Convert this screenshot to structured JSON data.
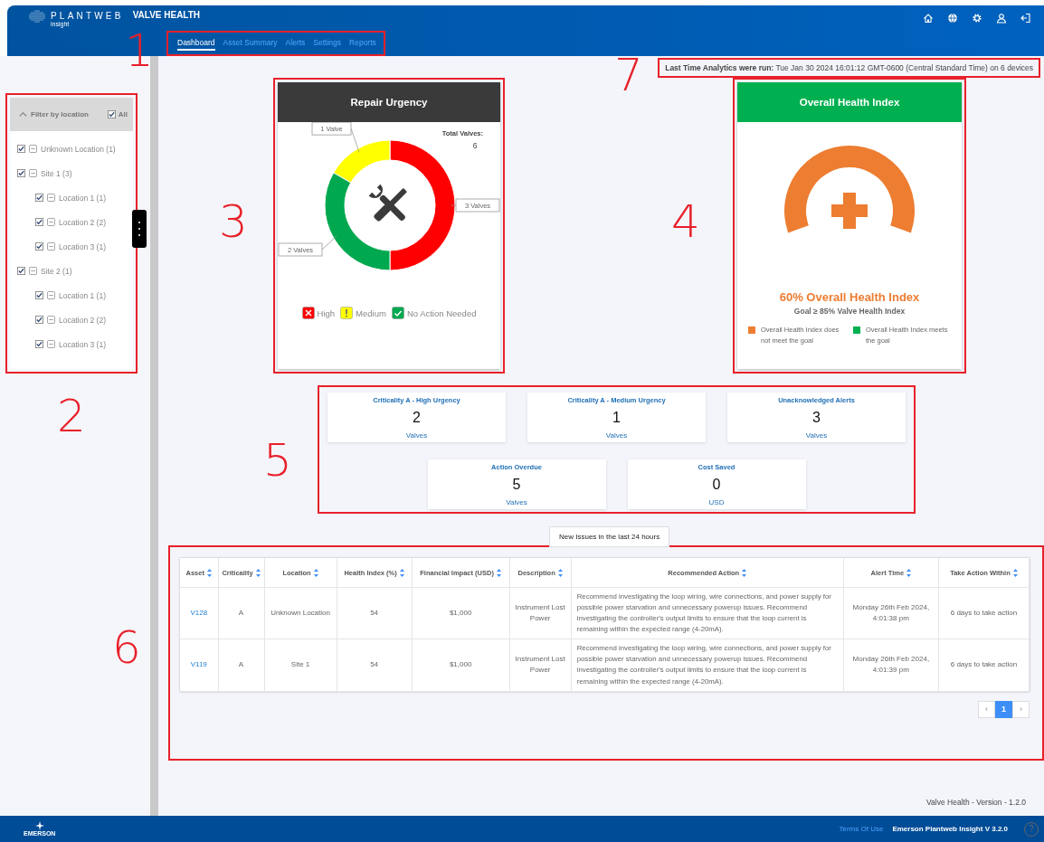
{
  "header": {
    "logo_text": "PLANTWEB",
    "logo_subtext": "insight",
    "app_title": "VALVE HEALTH"
  },
  "nav": {
    "annotation": "1",
    "tabs": [
      {
        "label": "Dashboard",
        "selected": true
      },
      {
        "label": "Asset Summary",
        "selected": false
      },
      {
        "label": "Alerts",
        "selected": false
      },
      {
        "label": "Settings",
        "selected": false
      },
      {
        "label": "Reports",
        "selected": false
      }
    ]
  },
  "analytics": {
    "annotation": "7",
    "text": "**Last Time Analytics were run:** Tue Jan 30 2024 16:01:12 GMT-0600 (Central Standard Time) on 6 devices"
  },
  "filter": {
    "annotation": "2",
    "title": "Filter by location",
    "expanded": true,
    "all": {
      "label": "All",
      "checked": true
    },
    "items": [
      {
        "label": "Unknown Location (1)",
        "checked": true
      },
      {
        "label": "Site 1 (3)",
        "checked": true,
        "children": [
          {
            "label": "Location 1 (1)",
            "checked": true
          },
          {
            "label": "Location 2 (2)",
            "checked": true
          },
          {
            "label": "Location 3 (1)",
            "checked": true
          }
        ]
      },
      {
        "label": "Site 2 (1)",
        "checked": true,
        "children": [
          {
            "label": "Location 1 (1)",
            "checked": true
          },
          {
            "label": "Location 2 (2)",
            "checked": true
          },
          {
            "label": "Location 3 (1)",
            "checked": true
          }
        ]
      }
    ]
  },
  "repair_urgency": {
    "annotation": "3",
    "title": "Repair Urgency",
    "total_label": "Total Valves:",
    "total": "6",
    "chart_data": {
      "type": "donut",
      "categories": [
        "High",
        "Medium",
        "No Action Needed"
      ],
      "values": [
        3,
        1,
        2
      ],
      "value_labels": [
        "3 Valves",
        "1 Valve",
        "2 Valves"
      ]
    },
    "legend": [
      {
        "kind": "cross",
        "color": "#ff0000"
      },
      {
        "kind": "exclamation",
        "color": "#ffff00"
      },
      {
        "kind": "check",
        "color": "#00a94f"
      }
    ]
  },
  "health": {
    "annotation": "4",
    "title": "Overall Health Index",
    "meets_goal": false,
    "value_text": "60% Overall Health Index",
    "goal_text": "Goal ≥ 85% Valve Health Index",
    "legend": [
      {
        "label": "Overall Health Index does not meet the goal",
        "color": "#ed7d31"
      },
      {
        "label": "Overall Health Index meets the goal",
        "color": "#00b050"
      }
    ]
  },
  "kpis": {
    "annotation": "5",
    "cards": [
      {
        "title": "Criticality A - High Urgency",
        "value": "2",
        "unit": "Valves"
      },
      {
        "title": "Criticality A - Medium Urgency",
        "value": "1",
        "unit": "Valves"
      },
      {
        "title": "Unacknowledged Alerts",
        "value": "3",
        "unit": "Valves"
      },
      {
        "title": "Action Overdue",
        "value": "5",
        "unit": "Valves"
      },
      {
        "title": "Cost Saved",
        "value": "0",
        "unit": "USD"
      }
    ]
  },
  "issues": {
    "annotation": "6",
    "tab": "New Issues in the last 24 hours",
    "columns": [
      "Asset",
      "Criticality",
      "Location",
      "Health Index (%)",
      "Financial Impact (USD)",
      "Description",
      "Recommended Action",
      "Alert Time",
      "Take Action Within"
    ],
    "rows": [
      {
        "cells": [
          "V128",
          "A",
          "Unknown Location",
          "54",
          "$1,000",
          "Instrument Lost Power",
          "Recommend investigating the loop wiring, wire connections, and power supply for possible power starvation and unnecessary powerup issues. Recommend investigating the controller's output limits to ensure that the loop current is remaining within the expected range (4-20mA).",
          "Monday 26th Feb 2024, 4:01:38 pm",
          "6 days to take action"
        ]
      },
      {
        "cells": [
          "V119",
          "A",
          "Site 1",
          "54",
          "$1,000",
          "Instrument Lost Power",
          "Recommend investigating the loop wiring, wire connections, and power supply for possible power starvation and unnecessary powerup issues. Recommend investigating the controller's output limits to ensure that the loop current is remaining within the expected range (4-20mA).",
          "Monday 26th Feb 2024, 4:01:39 pm",
          "6 days to take action"
        ]
      }
    ],
    "pagination": {
      "prev": "‹",
      "pages": [
        {
          "label": "1",
          "selected": true
        }
      ],
      "next": "›"
    }
  },
  "version": "Valve Health - Version - 1.2.0",
  "footer": {
    "logo_text": "EMERSON",
    "terms": "Terms Of Use",
    "product": "Emerson Plantweb Insight V 3.2.0",
    "help": "?"
  }
}
